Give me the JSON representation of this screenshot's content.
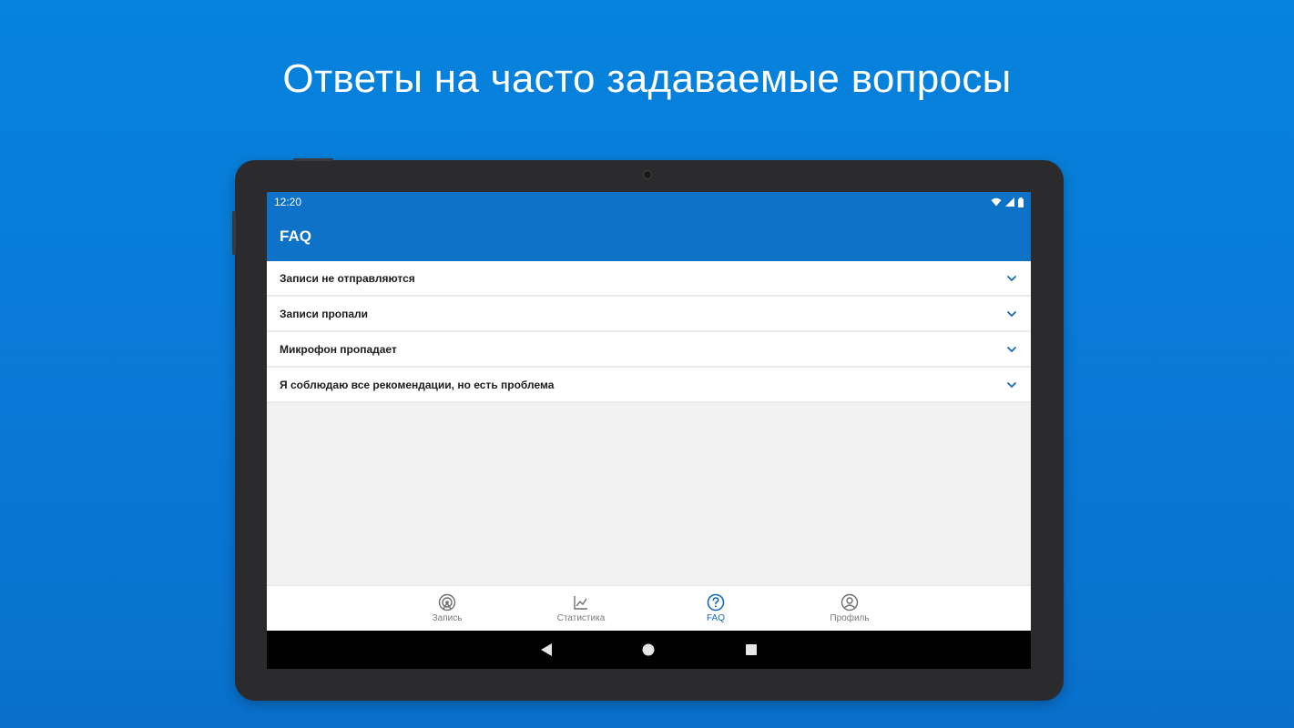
{
  "headline": "Ответы на часто задаваемые вопросы",
  "status": {
    "time": "12:20"
  },
  "appbar": {
    "title": "FAQ"
  },
  "faq": [
    {
      "label": "Записи не отправляются"
    },
    {
      "label": "Записи пропали"
    },
    {
      "label": "Микрофон пропадает"
    },
    {
      "label": "Я соблюдаю все рекомендации, но есть проблема"
    }
  ],
  "nav": [
    {
      "label": "Запись",
      "icon": "record-icon",
      "active": false
    },
    {
      "label": "Статистика",
      "icon": "chart-icon",
      "active": false
    },
    {
      "label": "FAQ",
      "icon": "help-icon",
      "active": true
    },
    {
      "label": "Профиль",
      "icon": "profile-icon",
      "active": false
    }
  ],
  "colors": {
    "accent": "#0f72c9",
    "active": "#1668b8",
    "background": "#0a78d6"
  }
}
